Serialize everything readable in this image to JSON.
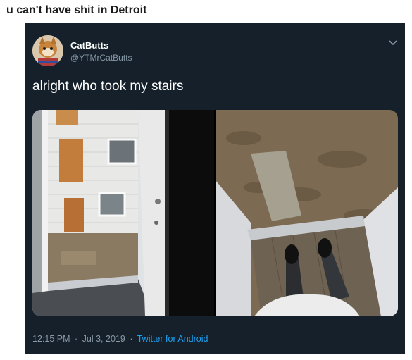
{
  "caption": "u can't have shit in Detroit",
  "tweet": {
    "display_name": "CatButts",
    "handle": "@YTMrCatButts",
    "text": "alright who took my stairs",
    "time": "12:15 PM",
    "date": "Jul 3, 2019",
    "separator": "·",
    "source": "Twitter for Android",
    "menu_icon": "chevron-down-icon"
  },
  "colors": {
    "tweet_background": "#15202b",
    "secondary_text": "#8899a6",
    "link": "#1da1f2"
  }
}
